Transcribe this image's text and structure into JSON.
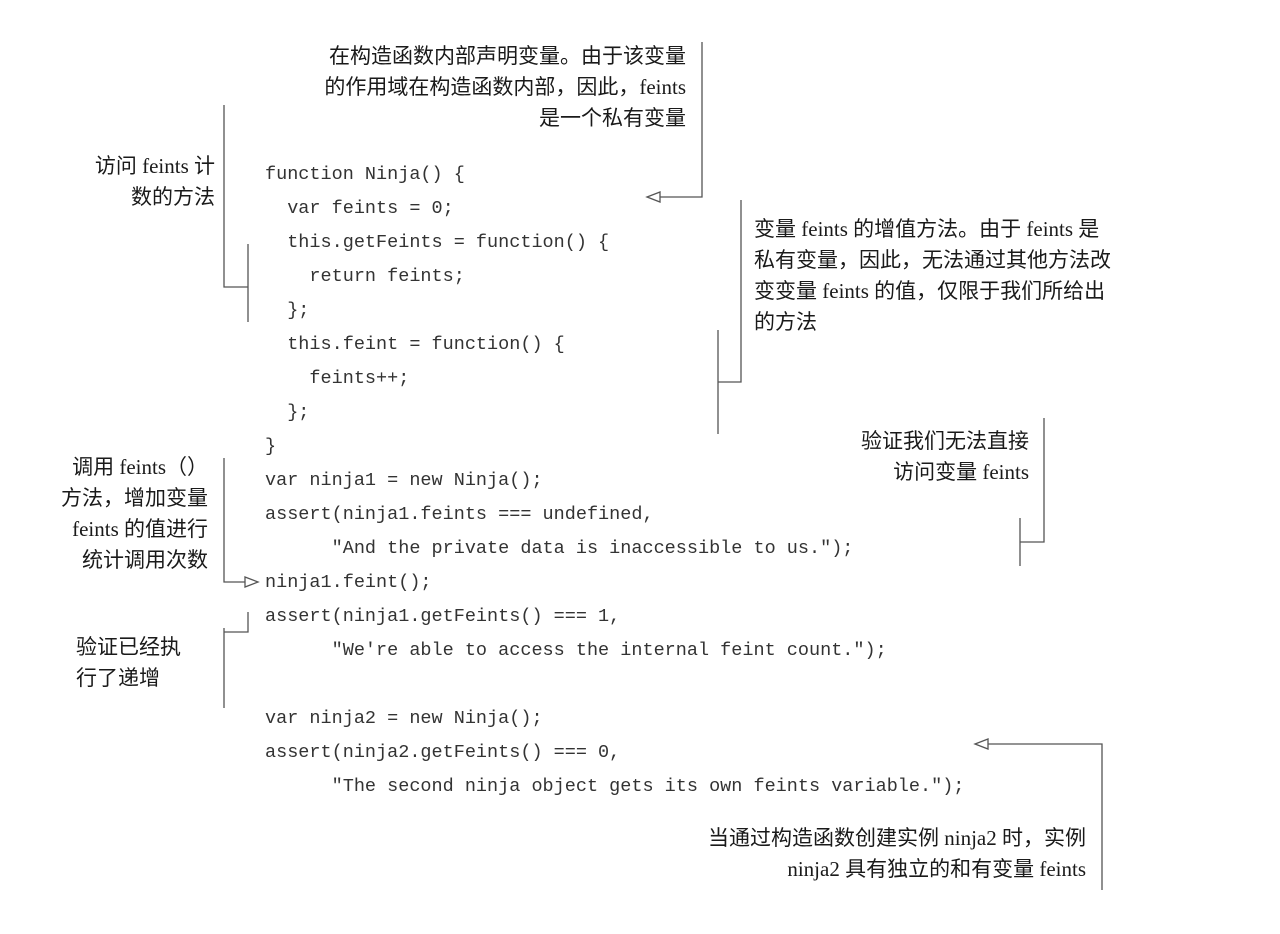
{
  "code_lines": [
    "function Ninja() {",
    "  var feints = 0;",
    "  this.getFeints = function() {",
    "    return feints;",
    "  };",
    "  this.feint = function() {",
    "    feints++;",
    "  };",
    "}",
    "var ninja1 = new Ninja();",
    "assert(ninja1.feints === undefined,",
    "      \"And the private data is inaccessible to us.\");",
    "ninja1.feint();",
    "assert(ninja1.getFeints() === 1,",
    "      \"We're able to access the internal feint count.\");",
    "",
    "var ninja2 = new Ninja();",
    "assert(ninja2.getFeints() === 0,",
    "      \"The second ninja object gets its own feints variable.\");"
  ],
  "annotations": {
    "private_var": [
      "在构造函数内部声明变量。由于该变量",
      "的作用域在构造函数内部，因此，feints",
      "是一个私有变量"
    ],
    "accessor": [
      "访问 feints 计",
      "数的方法"
    ],
    "increment": [
      "变量 feints 的增值方法。由于 feints 是",
      "私有变量，因此，无法通过其他方法改",
      "变变量 feints 的值，仅限于我们所给出",
      "的方法"
    ],
    "verify_no_access": [
      "验证我们无法直接",
      "访问变量 feints"
    ],
    "call_feint": [
      "调用 feints（）",
      "方法，增加变量",
      "feints 的值进行",
      "统计调用次数"
    ],
    "verify_increment": [
      "验证已经执",
      "行了递增"
    ],
    "ninja2": [
      "当通过构造函数创建实例 ninja2 时，实例",
      "ninja2 具有独立的和有变量 feints"
    ]
  }
}
